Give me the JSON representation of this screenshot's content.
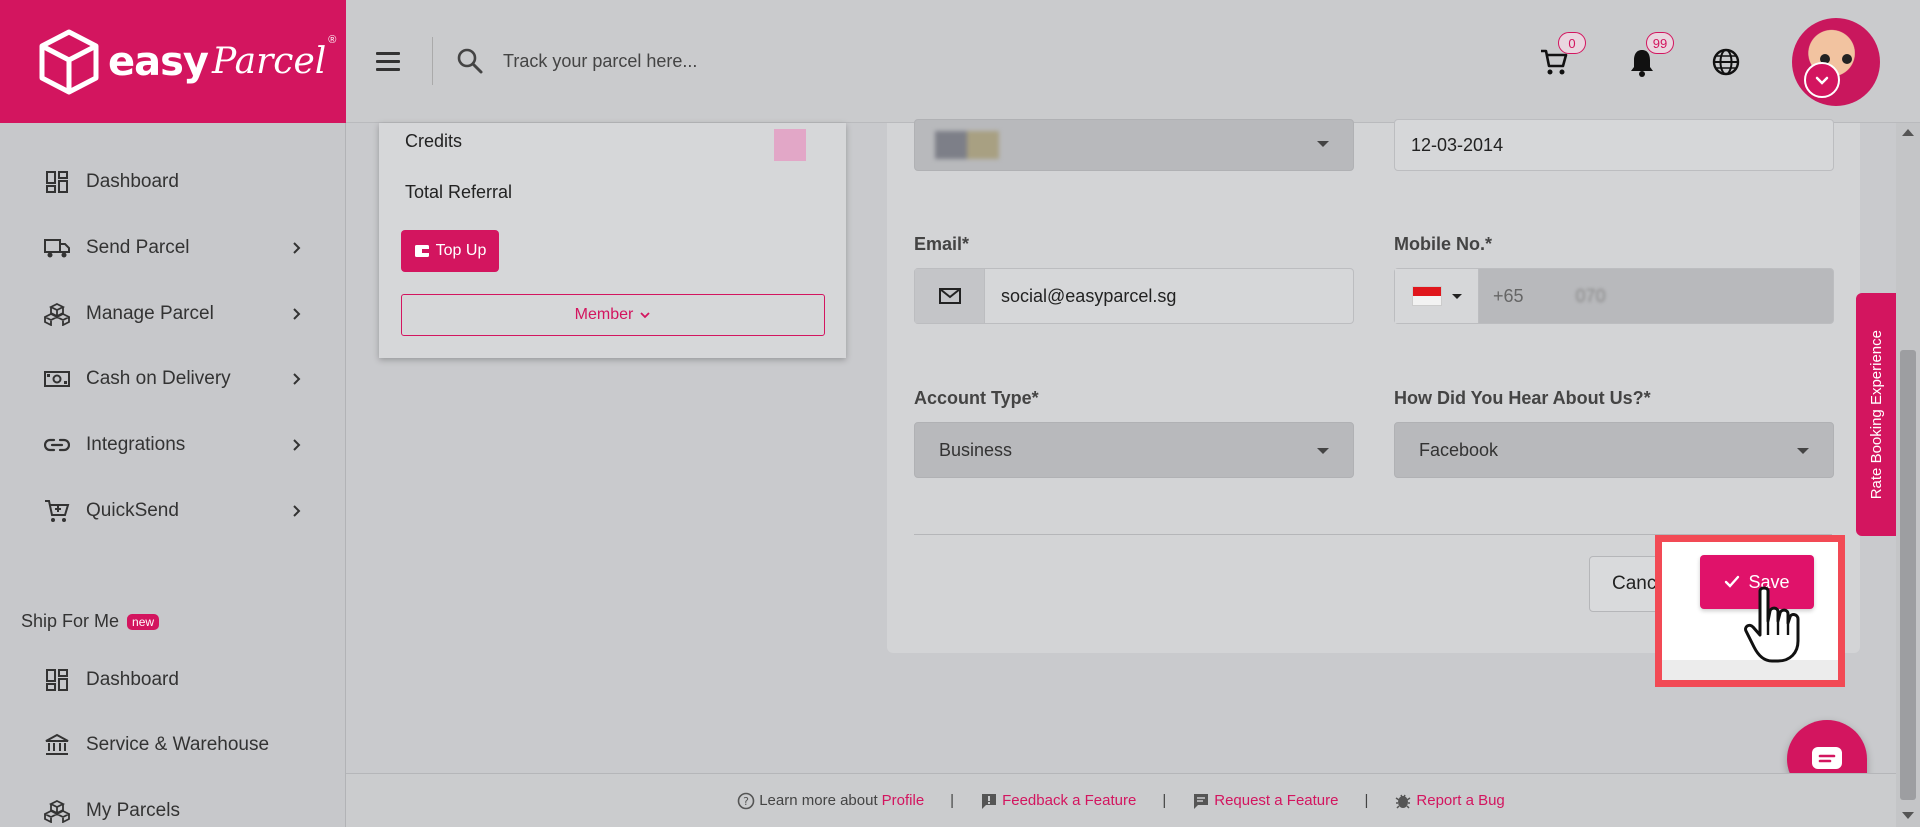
{
  "brand": {
    "name_easy": "easy",
    "name_parcel": "Parcel",
    "reg": "®"
  },
  "topbar": {
    "search_placeholder": "Track your parcel here...",
    "cart_count": "0",
    "notif_count": "99"
  },
  "sidebar": {
    "items": [
      {
        "label": "Dashboard",
        "icon": "dashboard-icon",
        "chevron": false
      },
      {
        "label": "Send Parcel",
        "icon": "truck-icon",
        "chevron": true
      },
      {
        "label": "Manage Parcel",
        "icon": "boxes-icon",
        "chevron": true
      },
      {
        "label": "Cash on Delivery",
        "icon": "cash-icon",
        "chevron": true
      },
      {
        "label": "Integrations",
        "icon": "link-icon",
        "chevron": true
      },
      {
        "label": "QuickSend",
        "icon": "cart-plus-icon",
        "chevron": true
      }
    ],
    "ship_for_me": {
      "title": "Ship For Me",
      "badge": "new",
      "items": [
        {
          "label": "Dashboard",
          "icon": "dashboard-icon"
        },
        {
          "label": "Service & Warehouse",
          "icon": "bank-icon"
        },
        {
          "label": "My Parcels",
          "icon": "boxes-icon"
        }
      ]
    }
  },
  "credits_card": {
    "credits_label": "Credits",
    "total_referral_label": "Total Referral",
    "topup_label": "Top Up",
    "member_label": "Member"
  },
  "form": {
    "date_value": "12-03-2014",
    "email_label": "Email*",
    "email_value": "social@easyparcel.sg",
    "mobile_label": "Mobile No.*",
    "mobile_prefix": "+65",
    "mobile_value": "070",
    "account_type_label": "Account Type*",
    "account_type_value": "Business",
    "hear_label": "How Did You Hear About Us?*",
    "hear_value": "Facebook",
    "cancel_label": "Cancel",
    "save_label": "Save"
  },
  "rate_tab": {
    "label": "Rate Booking Experience"
  },
  "footer": {
    "learn_prefix": "Learn more about",
    "learn_link": "Profile",
    "feedback": "Feedback a Feature",
    "request": "Request a Feature",
    "bug": "Report a Bug",
    "separator": "|"
  },
  "colors": {
    "brand": "#d3155f",
    "highlight": "#f24a55"
  }
}
